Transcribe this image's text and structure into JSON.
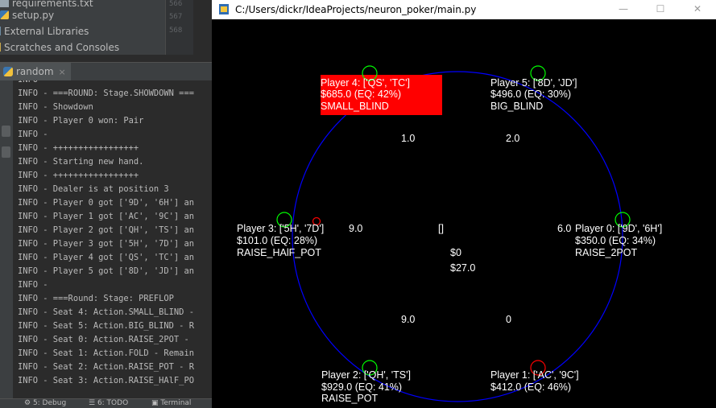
{
  "ide": {
    "project_items": [
      {
        "label": "requirements.txt",
        "icon": "text-file-icon"
      },
      {
        "label": "setup.py",
        "icon": "python-file-icon"
      },
      {
        "label": "External Libraries",
        "icon": "library-icon"
      },
      {
        "label": "Scratches and Consoles",
        "icon": "scratches-icon"
      }
    ],
    "gutter_numbers": [
      "566",
      "567",
      "568"
    ],
    "run_tab": {
      "label": "random",
      "icon": "python-icon",
      "close": "×"
    },
    "console_lines": [
      "INFO - ",
      "INFO - ===ROUND: Stage.SHOWDOWN ===",
      "INFO - Showdown",
      "INFO - Player 0 won: Pair",
      "INFO - ",
      "INFO - +++++++++++++++++",
      "INFO - Starting new hand.",
      "INFO - +++++++++++++++++",
      "INFO - Dealer is at position 3",
      "INFO - Player 0 got ['9D', '6H'] an",
      "INFO - Player 1 got ['AC', '9C'] an",
      "INFO - Player 2 got ['QH', 'TS'] an",
      "INFO - Player 3 got ['5H', '7D'] an",
      "INFO - Player 4 got ['QS', 'TC'] an",
      "INFO - Player 5 got ['8D', 'JD'] an",
      "INFO - ",
      "INFO - ===Round: Stage: PREFLOP",
      "INFO - Seat 4: Action.SMALL_BLIND -",
      "INFO - Seat 5: Action.BIG_BLIND - R",
      "INFO - Seat 0: Action.RAISE_2POT - ",
      "INFO - Seat 1: Action.FOLD - Remain",
      "INFO - Seat 2: Action.RAISE_POT - R",
      "INFO - Seat 3: Action.RAISE_HAlF_PO"
    ],
    "bottom_tabs": [
      {
        "label": "5: Debug",
        "icon": "debug-icon"
      },
      {
        "label": "6: TODO",
        "icon": "todo-icon"
      },
      {
        "label": "Terminal",
        "icon": "terminal-icon"
      }
    ]
  },
  "window": {
    "title": "C:/Users/dickr/IdeaProjects/neuron_poker/main.py",
    "minimize": "—",
    "maximize": "☐",
    "close": "✕"
  },
  "table": {
    "colors": {
      "background": "#000000",
      "table_circle": "#0000ff",
      "active_player_bg": "#ff0000",
      "seat_active": "#00ff00",
      "seat_folded": "#ff0000",
      "dealer_button": "#ff0000",
      "text": "#ffffff"
    },
    "players": [
      {
        "id": 4,
        "name": "Player 4: ['QS', 'TC']",
        "equity": "$685.0 (EQ: 42%)",
        "action": "SMALL_BLIND",
        "bet": "1.0",
        "active": true,
        "folded": false
      },
      {
        "id": 5,
        "name": "Player 5: ['8D', 'JD']",
        "equity": "$496.0 (EQ: 30%)",
        "action": "BIG_BLIND",
        "bet": "2.0",
        "active": false,
        "folded": false
      },
      {
        "id": 3,
        "name": "Player 3: ['5H', '7D']",
        "equity": "$101.0 (EQ: 28%)",
        "action": "RAISE_HAlF_POT",
        "bet": "9.0",
        "active": false,
        "folded": false
      },
      {
        "id": 0,
        "name": "Player 0: ['9D', '6H']",
        "equity": "$350.0 (EQ: 34%)",
        "action": "RAISE_2POT",
        "bet": "6.0",
        "active": false,
        "folded": false
      },
      {
        "id": 2,
        "name": "Player 2: ['QH', 'TS']",
        "equity": "$929.0 (EQ: 41%)",
        "action": "RAISE_POT",
        "bet": "9.0",
        "active": false,
        "folded": false
      },
      {
        "id": 1,
        "name": "Player 1: ['AC', '9C']",
        "equity": "$412.0 (EQ: 46%)",
        "action": "",
        "bet": "0",
        "active": false,
        "folded": true
      }
    ],
    "community_cards": "[]",
    "pot_main": "$0",
    "pot_total": "$27.0"
  }
}
